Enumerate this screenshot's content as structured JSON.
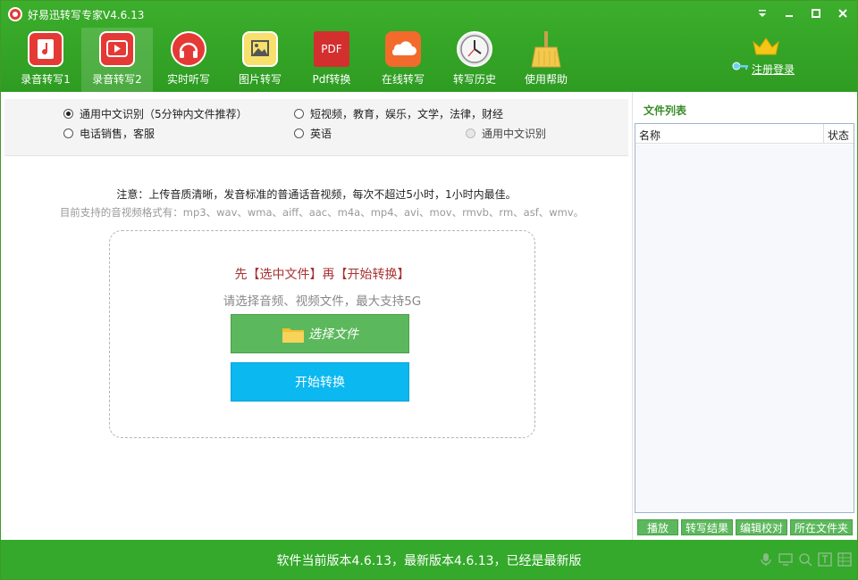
{
  "window": {
    "title": "好易迅转写专家V4.6.13",
    "accent": "#34a92b",
    "controls": [
      "menu",
      "minimize",
      "maximize",
      "close"
    ]
  },
  "toolbar": [
    {
      "label": "录音转写1",
      "icon": "music-note-icon",
      "active": false
    },
    {
      "label": "录音转写2",
      "icon": "play-icon",
      "active": true
    },
    {
      "label": "实时听写",
      "icon": "headphones-icon",
      "active": false
    },
    {
      "label": "图片转写",
      "icon": "image-icon",
      "active": false
    },
    {
      "label": "Pdf转换",
      "icon": "pdf-icon",
      "icon_text": "PDF",
      "active": false
    },
    {
      "label": "在线转写",
      "icon": "cloud-icon",
      "active": false
    },
    {
      "label": "转写历史",
      "icon": "clock-icon",
      "active": false
    },
    {
      "label": "使用帮助",
      "icon": "broom-icon",
      "active": false
    }
  ],
  "register": {
    "label": "注册登录"
  },
  "options": [
    {
      "label": "通用中文识别（5分钟内文件推荐）",
      "checked": true,
      "disabled": false
    },
    {
      "label": "短视频，教育，娱乐，文学，法律，财经",
      "checked": false,
      "disabled": false
    },
    {
      "label": "电话销售，客服",
      "checked": false,
      "disabled": false
    },
    {
      "label": "英语",
      "checked": false,
      "disabled": false
    },
    {
      "label": "通用中文识别",
      "checked": false,
      "disabled": true
    }
  ],
  "notice": "注意：上传音质清晰，发音标准的普通话音视频，每次不超过5小时，1小时内最佳。",
  "formats": "目前支持的音视频格式有：mp3、wav、wma、aiff、aac、m4a、mp4、avi、mov、rmvb、rm、asf、wmv。",
  "dropzone": {
    "title": "先【选中文件】再【开始转换】",
    "subtitle": "请选择音频、视频文件，最大支持5G",
    "select_label": "选择文件",
    "start_label": "开始转换"
  },
  "file_list": {
    "title": "文件列表",
    "columns": [
      "名称",
      "状态"
    ],
    "rows": [],
    "actions": [
      "播放",
      "转写结果",
      "编辑校对",
      "所在文件夹"
    ]
  },
  "status": {
    "text": "软件当前版本4.6.13，最新版本4.6.13，已经是最新版",
    "icons": [
      "microphone-icon",
      "monitor-icon",
      "search-icon",
      "translate-icon",
      "table-icon"
    ]
  }
}
